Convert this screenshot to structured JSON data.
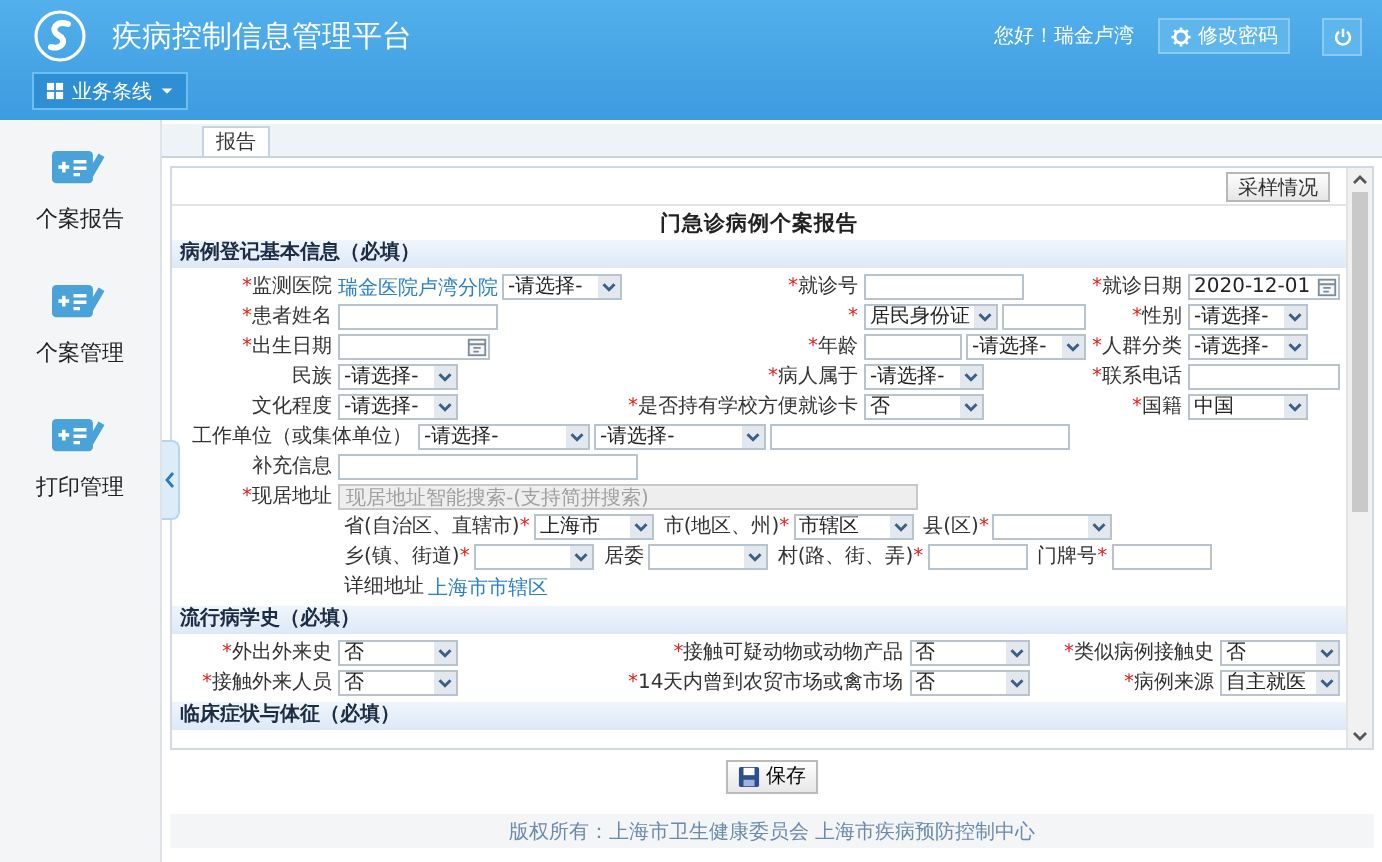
{
  "header": {
    "title": "疾病控制信息管理平台",
    "greeting": "您好！瑞金卢湾",
    "change_password": "修改密码",
    "menu_button": "业务条线"
  },
  "sidebar": {
    "items": [
      {
        "label": "个案报告"
      },
      {
        "label": "个案管理"
      },
      {
        "label": "打印管理"
      }
    ]
  },
  "tabs": [
    {
      "label": "报告",
      "selected": true
    }
  ],
  "form": {
    "sample_button": "采样情况",
    "title": "门急诊病例个案报告",
    "sections": [
      {
        "title": "病例登记基本信息（必填）",
        "rows": [
          {
            "kind": "grid",
            "cells": [
              {
                "mark": "*",
                "label": "监测医院",
                "controls": [
                  {
                    "kind": "link",
                    "text": "瑞金医院卢湾分院"
                  },
                  {
                    "kind": "select",
                    "value": "-请选择-"
                  }
                ]
              },
              {
                "mark": "*",
                "label": "就诊号",
                "controls": [
                  {
                    "kind": "input"
                  }
                ]
              },
              {
                "mark": "*",
                "label": "就诊日期",
                "controls": [
                  {
                    "kind": "date",
                    "value": "2020-12-01"
                  }
                ]
              }
            ]
          },
          {
            "kind": "grid",
            "cells": [
              {
                "mark": "*",
                "label": "患者姓名",
                "controls": [
                  {
                    "kind": "input"
                  }
                ]
              },
              {
                "mark": "*",
                "controls": [
                  {
                    "kind": "select",
                    "value": "居民身份证"
                  },
                  {
                    "kind": "input"
                  }
                ]
              },
              {
                "mark": "*",
                "label": "性别",
                "controls": [
                  {
                    "kind": "select",
                    "value": "-请选择-"
                  }
                ]
              }
            ]
          },
          {
            "kind": "grid",
            "cells": [
              {
                "mark": "*",
                "label": "出生日期",
                "controls": [
                  {
                    "kind": "date"
                  }
                ]
              },
              {
                "mark": "*",
                "label": "年龄",
                "controls": [
                  {
                    "kind": "input"
                  },
                  {
                    "kind": "select",
                    "value": "-请选择-"
                  }
                ]
              },
              {
                "mark": "*",
                "label": "人群分类",
                "controls": [
                  {
                    "kind": "select",
                    "value": "-请选择-"
                  }
                ]
              }
            ]
          },
          {
            "kind": "grid",
            "cells": [
              {
                "label": "民族",
                "controls": [
                  {
                    "kind": "select",
                    "value": "-请选择-"
                  }
                ]
              },
              {
                "mark": "*",
                "label": "病人属于",
                "controls": [
                  {
                    "kind": "select",
                    "value": "-请选择-"
                  }
                ]
              },
              {
                "mark": "*",
                "label": "联系电话",
                "controls": [
                  {
                    "kind": "input"
                  }
                ]
              }
            ]
          },
          {
            "kind": "grid",
            "cells": [
              {
                "label": "文化程度",
                "controls": [
                  {
                    "kind": "select",
                    "value": "-请选择-"
                  }
                ]
              },
              {
                "mark": "*",
                "label": "是否持有学校方便就诊卡",
                "controls": [
                  {
                    "kind": "select",
                    "value": "否"
                  }
                ]
              },
              {
                "mark": "*",
                "label": "国籍",
                "controls": [
                  {
                    "kind": "select",
                    "value": "中国"
                  }
                ]
              }
            ]
          },
          {
            "kind": "wide",
            "cells": [
              {
                "label": "工作单位（或集体单位）",
                "controls": [
                  {
                    "kind": "select",
                    "value": "-请选择-"
                  },
                  {
                    "kind": "select",
                    "value": "-请选择-"
                  },
                  {
                    "kind": "input"
                  }
                ]
              }
            ]
          },
          {
            "kind": "wide",
            "cells": [
              {
                "label": "补充信息",
                "controls": [
                  {
                    "kind": "input"
                  }
                ]
              }
            ]
          },
          {
            "kind": "wide",
            "cells": [
              {
                "mark": "*",
                "label": "现居地址",
                "controls": [
                  {
                    "kind": "search",
                    "placeholder": "现居地址智能搜索-(支持简拼搜索)"
                  }
                ]
              }
            ]
          },
          {
            "kind": "address",
            "parts": [
              {
                "label": "省(自治区、直辖市)",
                "mark": "*",
                "controls": [
                  {
                    "kind": "select",
                    "value": "上海市"
                  }
                ]
              },
              {
                "label": "市(地区、州)",
                "mark": "*",
                "controls": [
                  {
                    "kind": "select",
                    "value": "市辖区"
                  }
                ]
              },
              {
                "label": "县(区)",
                "mark": "*",
                "controls": [
                  {
                    "kind": "select"
                  }
                ]
              }
            ]
          },
          {
            "kind": "address",
            "parts": [
              {
                "label": "乡(镇、街道)",
                "mark": "*",
                "controls": [
                  {
                    "kind": "select"
                  }
                ]
              },
              {
                "label": "居委",
                "controls": [
                  {
                    "kind": "select"
                  }
                ]
              },
              {
                "label": "村(路、街、弄)",
                "mark": "*",
                "controls": [
                  {
                    "kind": "input"
                  }
                ]
              },
              {
                "label": "门牌号",
                "mark": "*",
                "controls": [
                  {
                    "kind": "input"
                  }
                ]
              }
            ]
          },
          {
            "kind": "address",
            "parts": [
              {
                "label": "详细地址",
                "controls": [
                  {
                    "kind": "link",
                    "text": "上海市市辖区"
                  }
                ]
              }
            ]
          }
        ]
      },
      {
        "title": "流行病学史（必填）",
        "rows": [
          {
            "kind": "grid",
            "cells": [
              {
                "mark": "*",
                "label": "外出外来史",
                "controls": [
                  {
                    "kind": "select",
                    "value": "否"
                  }
                ]
              },
              {
                "mark": "*",
                "label": "接触可疑动物或动物产品",
                "controls": [
                  {
                    "kind": "select",
                    "value": "否"
                  }
                ]
              },
              {
                "mark": "*",
                "label": "类似病例接触史",
                "controls": [
                  {
                    "kind": "select",
                    "value": "否"
                  }
                ]
              }
            ]
          },
          {
            "kind": "grid",
            "cells": [
              {
                "mark": "*",
                "label": "接触外来人员",
                "controls": [
                  {
                    "kind": "select",
                    "value": "否"
                  }
                ]
              },
              {
                "mark": "*",
                "label": "14天内曾到农贸市场或禽市场",
                "controls": [
                  {
                    "kind": "select",
                    "value": "否"
                  }
                ]
              },
              {
                "mark": "*",
                "label": "病例来源",
                "controls": [
                  {
                    "kind": "select",
                    "value": "自主就医"
                  }
                ]
              }
            ]
          }
        ]
      },
      {
        "title": "临床症状与体征（必填）"
      }
    ]
  },
  "save_button": "保存",
  "footer": "版权所有：上海市卫生健康委员会 上海市疾病预防控制中心"
}
